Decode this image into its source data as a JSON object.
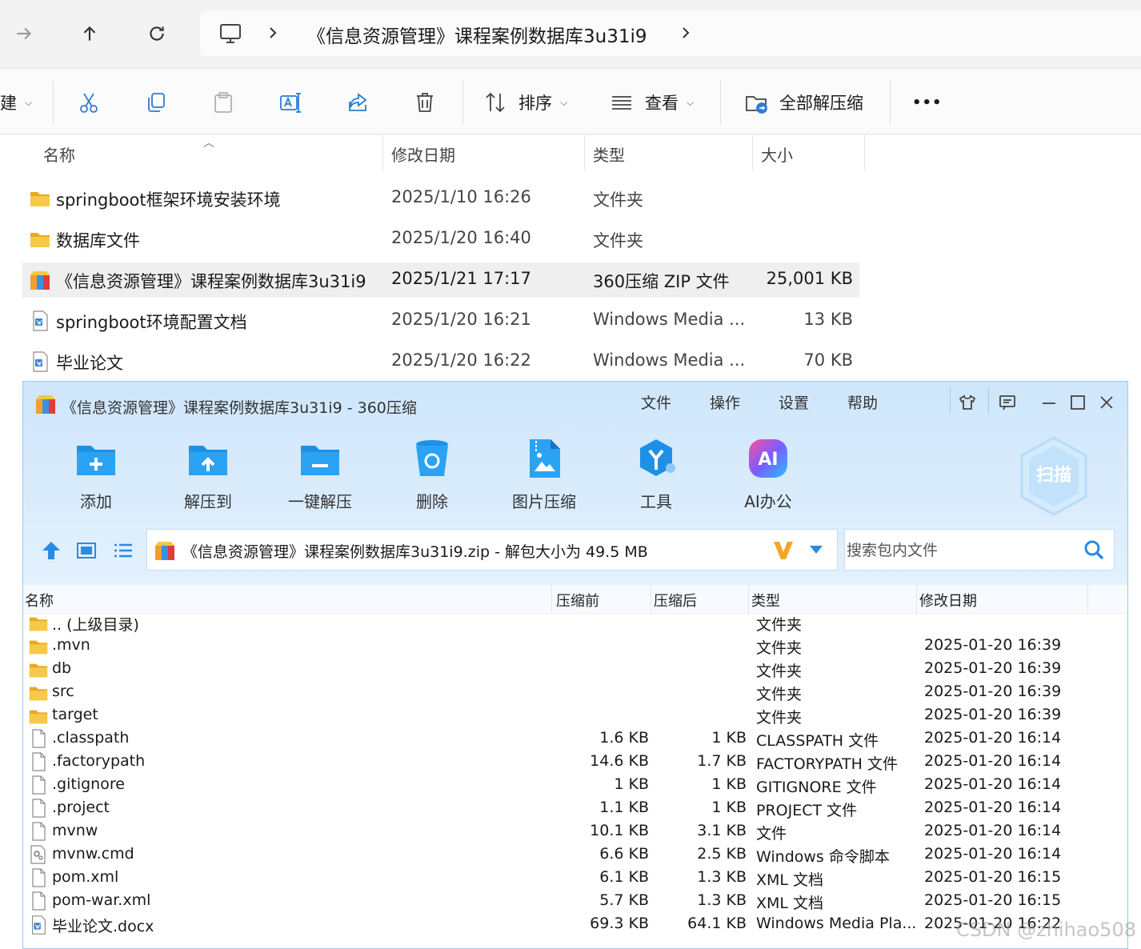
{
  "explorer": {
    "path": "《信息资源管理》课程案例数据库3u31i9",
    "commands": {
      "new_partial": "建",
      "sort": "排序",
      "view": "查看",
      "extract_all": "全部解压缩",
      "more": "•••"
    },
    "columns": {
      "name": "名称",
      "date": "修改日期",
      "type": "类型",
      "size": "大小"
    },
    "files": [
      {
        "name": "springboot框架环境安装环境",
        "date": "2025/1/10 16:26",
        "type": "文件夹",
        "size": "",
        "icon": "folder-icon"
      },
      {
        "name": "数据库文件",
        "date": "2025/1/20 16:40",
        "type": "文件夹",
        "size": "",
        "icon": "folder-icon"
      },
      {
        "name": "《信息资源管理》课程案例数据库3u31i9",
        "date": "2025/1/21 17:17",
        "type": "360压缩 ZIP 文件",
        "size": "25,001 KB",
        "icon": "zip-archive-icon",
        "selected": true
      },
      {
        "name": "springboot环境配置文档",
        "date": "2025/1/20 16:21",
        "type": "Windows Media ...",
        "size": "13 KB",
        "icon": "document-icon"
      },
      {
        "name": "毕业论文",
        "date": "2025/1/20 16:22",
        "type": "Windows Media ...",
        "size": "70 KB",
        "icon": "document-icon"
      }
    ]
  },
  "zip": {
    "title": "《信息资源管理》课程案例数据库3u31i9 - 360压缩",
    "menu": [
      "文件",
      "操作",
      "设置",
      "帮助"
    ],
    "tools": [
      {
        "label": "添加",
        "icon": "add-folder-icon"
      },
      {
        "label": "解压到",
        "icon": "extract-to-icon"
      },
      {
        "label": "一键解压",
        "icon": "one-click-extract-icon"
      },
      {
        "label": "删除",
        "icon": "recycle-bin-icon"
      },
      {
        "label": "图片压缩",
        "icon": "image-compress-icon"
      },
      {
        "label": "工具",
        "icon": "tools-icon"
      },
      {
        "label": "AI办公",
        "icon": "ai-office-icon"
      }
    ],
    "scan_label": "扫描",
    "ai_badge": "AI",
    "path_text": "《信息资源管理》课程案例数据库3u31i9.zip - 解包大小为 49.5 MB",
    "search_placeholder": "搜索包内文件",
    "columns": {
      "name": "名称",
      "before": "压缩前",
      "after": "压缩后",
      "type": "类型",
      "date": "修改日期"
    },
    "rows": [
      {
        "name": ".. (上级目录)",
        "before": "",
        "after": "",
        "type": "文件夹",
        "date": "",
        "icon": "folder-icon"
      },
      {
        "name": ".mvn",
        "before": "",
        "after": "",
        "type": "文件夹",
        "date": "2025-01-20 16:39",
        "icon": "folder-icon"
      },
      {
        "name": "db",
        "before": "",
        "after": "",
        "type": "文件夹",
        "date": "2025-01-20 16:39",
        "icon": "folder-icon"
      },
      {
        "name": "src",
        "before": "",
        "after": "",
        "type": "文件夹",
        "date": "2025-01-20 16:39",
        "icon": "folder-icon"
      },
      {
        "name": "target",
        "before": "",
        "after": "",
        "type": "文件夹",
        "date": "2025-01-20 16:39",
        "icon": "folder-icon"
      },
      {
        "name": ".classpath",
        "before": "1.6 KB",
        "after": "1 KB",
        "type": "CLASSPATH 文件",
        "date": "2025-01-20 16:14",
        "icon": "file-icon"
      },
      {
        "name": ".factorypath",
        "before": "14.6 KB",
        "after": "1.7 KB",
        "type": "FACTORYPATH 文件",
        "date": "2025-01-20 16:14",
        "icon": "file-icon"
      },
      {
        "name": ".gitignore",
        "before": "1 KB",
        "after": "1 KB",
        "type": "GITIGNORE 文件",
        "date": "2025-01-20 16:14",
        "icon": "file-icon"
      },
      {
        "name": ".project",
        "before": "1.1 KB",
        "after": "1 KB",
        "type": "PROJECT 文件",
        "date": "2025-01-20 16:14",
        "icon": "file-icon"
      },
      {
        "name": "mvnw",
        "before": "10.1 KB",
        "after": "3.1 KB",
        "type": "文件",
        "date": "2025-01-20 16:14",
        "icon": "file-icon"
      },
      {
        "name": "mvnw.cmd",
        "before": "6.6 KB",
        "after": "2.5 KB",
        "type": "Windows 命令脚本",
        "date": "2025-01-20 16:14",
        "icon": "cmd-script-icon"
      },
      {
        "name": "pom.xml",
        "before": "6.1 KB",
        "after": "1.3 KB",
        "type": "XML 文档",
        "date": "2025-01-20 16:15",
        "icon": "file-icon"
      },
      {
        "name": "pom-war.xml",
        "before": "5.7 KB",
        "after": "1.3 KB",
        "type": "XML 文档",
        "date": "2025-01-20 16:15",
        "icon": "file-icon"
      },
      {
        "name": "毕业论文.docx",
        "before": "69.3 KB",
        "after": "64.1 KB",
        "type": "Windows Media Pla...",
        "date": "2025-01-20 16:22",
        "icon": "document-icon"
      }
    ]
  },
  "watermark": "CSDN @zhihao508",
  "colors": {
    "folder": "#f4c43f",
    "zip_accent": "#1e90e6",
    "window_border": "#9cc8ee"
  }
}
